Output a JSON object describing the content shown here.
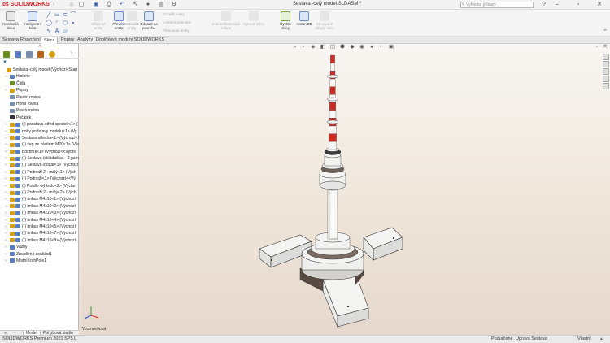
{
  "titlebar": {
    "brand": "SOLIDWORKS",
    "document_title": "Sestava -celý model.SLDASM *",
    "search_placeholder": "Vyhledat příkazy"
  },
  "ribbon": {
    "buttons": [
      {
        "label": "Nezávislá skica",
        "enabled": true
      },
      {
        "label": "Inteligentní kóta",
        "enabled": true
      },
      {
        "label": "Oříznout entity",
        "enabled": false
      },
      {
        "label": "Převést entity",
        "enabled": true
      },
      {
        "label": "Odsadit entity",
        "enabled": false
      },
      {
        "label": "Odsadit na povrchu",
        "enabled": true
      },
      {
        "label": "Zrcadlit entity",
        "enabled": false
      },
      {
        "label": "Lineární pole skic",
        "enabled": false
      },
      {
        "label": "Přesunout entity",
        "enabled": false
      },
      {
        "label": "Zobrazit/odstranit relace",
        "enabled": false
      },
      {
        "label": "Opravit skicu",
        "enabled": false
      },
      {
        "label": "Rychlé skicy",
        "enabled": true
      },
      {
        "label": "Instant2D",
        "enabled": true
      },
      {
        "label": "Stínované obrysy skici",
        "enabled": false
      }
    ]
  },
  "command_tabs": [
    "Sestava",
    "Rozvržení",
    "Skica",
    "Popisy",
    "Analýzy",
    "Doplňkové moduly SOLIDWORKS"
  ],
  "active_command_tab": "Skica",
  "tree": {
    "root": "Sestava -celý model (Výchozí<Stan",
    "items": [
      {
        "label": "Historie",
        "icon": "history-icon",
        "color": "#5a7dbf",
        "expand": true
      },
      {
        "label": "Čidla",
        "icon": "sensor-icon",
        "color": "#6b8e23",
        "expand": false
      },
      {
        "label": "Popisy",
        "icon": "annotation-icon",
        "color": "#d4a017",
        "expand": true
      },
      {
        "label": "Přední rovina",
        "icon": "plane-icon",
        "color": "#7a8fb0",
        "expand": false
      },
      {
        "label": "Horní rovina",
        "icon": "plane-icon",
        "color": "#7a8fb0",
        "expand": false
      },
      {
        "label": "Pravá rovina",
        "icon": "plane-icon",
        "color": "#7a8fb0",
        "expand": false
      },
      {
        "label": "Počátek",
        "icon": "origin-icon",
        "color": "#333333",
        "expand": false
      },
      {
        "label": "(f) podstava-střed-spodek<1> (",
        "icon": "part-icon",
        "color": "#d4a017",
        "expand": true
      },
      {
        "label": "nohy podstavy modelu<1> (Vý",
        "icon": "part-icon",
        "color": "#d4a017",
        "expand": true
      },
      {
        "label": "Sestava-střecha<1> (Výchozí<S",
        "icon": "assembly-icon",
        "color": "#d4a017",
        "expand": true
      },
      {
        "label": "(-) čep ze závitem M20<1> (Výc",
        "icon": "part-icon",
        "color": "#d4a017",
        "expand": true
      },
      {
        "label": "Bochník<1> (Výchozí<<Výcho",
        "icon": "part-icon",
        "color": "#d4a017",
        "expand": true
      },
      {
        "label": "(-) Sestava (skládačka) - 2 patro",
        "icon": "assembly-icon",
        "color": "#d4a017",
        "expand": true
      },
      {
        "label": "(-) Sestava-stožár<1> (Výchozí",
        "icon": "assembly-icon",
        "color": "#d4a017",
        "expand": true
      },
      {
        "label": "(-) Podnoží 2 - malý<1> (Vých",
        "icon": "part-icon",
        "color": "#d4a017",
        "expand": true
      },
      {
        "label": "(-) Podnoží<1> (Výchozí<<Vý",
        "icon": "part-icon",
        "color": "#d4a017",
        "expand": true
      },
      {
        "label": "(f) Pradlo -výtisklo<2> (Výcho",
        "icon": "part-icon",
        "color": "#d4a017",
        "expand": true
      },
      {
        "label": "(-) Podnoží 2 - malý<2> (Vých",
        "icon": "part-icon",
        "color": "#d4a017",
        "expand": true
      },
      {
        "label": "(-) Imbus M4x10<1> (Výchozí",
        "icon": "part-icon",
        "color": "#d4a017",
        "expand": true
      },
      {
        "label": "(-) Imbus M4x10<2> (Výchozí",
        "icon": "part-icon",
        "color": "#d4a017",
        "expand": true
      },
      {
        "label": "(-) Imbus M4x10<3> (Výchozí",
        "icon": "part-icon",
        "color": "#d4a017",
        "expand": true
      },
      {
        "label": "(-) Imbus M4x10<4> (Výchozí",
        "icon": "part-icon",
        "color": "#d4a017",
        "expand": true
      },
      {
        "label": "(-) Imbus M4x10<5> (Výchozí",
        "icon": "part-icon",
        "color": "#d4a017",
        "expand": true
      },
      {
        "label": "(-) Imbus M4x10<7> (Výchozí",
        "icon": "part-icon",
        "color": "#d4a017",
        "expand": true
      },
      {
        "label": "(-) Imbus M4x10<8> (Výchozí",
        "icon": "part-icon",
        "color": "#d4a017",
        "expand": true
      },
      {
        "label": "Vazby",
        "icon": "mates-icon",
        "color": "#5a7dbf",
        "expand": true
      },
      {
        "label": "Zrcadlená součást1",
        "icon": "mirror-icon",
        "color": "#5a7dbf",
        "expand": true
      },
      {
        "label": "MístníKruhPole1",
        "icon": "pattern-icon",
        "color": "#5a7dbf",
        "expand": true
      }
    ]
  },
  "bottom_tabs": [
    "Model",
    "Pohybová studie 1"
  ],
  "viewport": {
    "view_label": "*Izometrická",
    "triad_labels": {
      "x": "x",
      "y": "y",
      "z": "z"
    }
  },
  "statusbar": {
    "left": "SOLIDWORKS Premium 2021 SP5.0",
    "state": "Podurčené",
    "editing": "Úprava Sestava",
    "units": "Vlastní"
  },
  "colors": {
    "brand_red": "#d8232a",
    "tower_red": "#cc2a22",
    "tower_white": "#f4f4f2",
    "accent_blue": "#3a5da8"
  }
}
